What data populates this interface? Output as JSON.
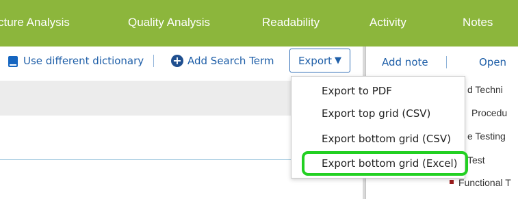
{
  "tabs": [
    {
      "label": "cture Analysis"
    },
    {
      "label": "Quality Analysis"
    },
    {
      "label": "Readability"
    },
    {
      "label": "Activity"
    },
    {
      "label": "Notes"
    }
  ],
  "toolbar": {
    "use_dictionary_label": "Use different dictionary",
    "add_search_term_label": "Add Search Term",
    "export_label": "Export",
    "export_caret": "▼",
    "dictionary_icon": "book-icon",
    "add_icon": "plus-circle-icon"
  },
  "export_menu": {
    "items": [
      {
        "label": "Export to PDF"
      },
      {
        "label": "Export top grid (CSV)"
      },
      {
        "label": "Export bottom grid (CSV)"
      },
      {
        "label": "Export bottom grid (Excel)"
      }
    ],
    "highlighted_index": 3
  },
  "notes_panel": {
    "add_note_label": "Add note",
    "open_label": "Open",
    "partial_items": [
      {
        "text": "d Techni"
      },
      {
        "text": "Procedu"
      },
      {
        "text": "e Testing"
      },
      {
        "text": "Test"
      },
      {
        "text": "Functional T"
      }
    ]
  },
  "colors": {
    "tab_bar": "#8cb63c",
    "link": "#1f5fa8",
    "highlight_border": "#22d022",
    "bullet": "#9b1c1c"
  }
}
